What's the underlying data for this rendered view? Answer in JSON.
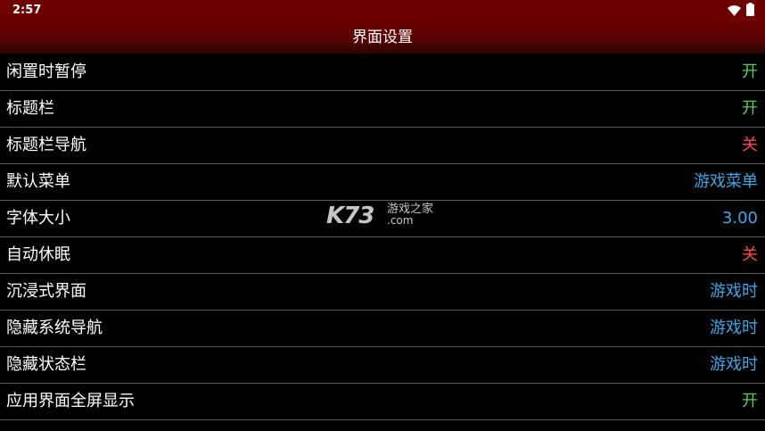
{
  "status_bar": {
    "time": "2:57",
    "icons": [
      "wifi-icon",
      "battery-icon"
    ]
  },
  "header": {
    "title": "界面设置"
  },
  "settings": [
    {
      "label": "闲置时暂停",
      "value": "开",
      "color": "#4cd35a"
    },
    {
      "label": "标题栏",
      "value": "开",
      "color": "#4cd35a"
    },
    {
      "label": "标题栏导航",
      "value": "关",
      "color": "#ff4a4a"
    },
    {
      "label": "默认菜单",
      "value": "游戏菜单",
      "color": "#37a9e6"
    },
    {
      "label": "字体大小",
      "value": "3.00",
      "color": "#37a9e6"
    },
    {
      "label": "自动休眠",
      "value": "关",
      "color": "#ff4a4a"
    },
    {
      "label": "沉浸式界面",
      "value": "游戏时",
      "color": "#37a9e6"
    },
    {
      "label": "隐藏系统导航",
      "value": "游戏时",
      "color": "#37a9e6"
    },
    {
      "label": "隐藏状态栏",
      "value": "游戏时",
      "color": "#37a9e6"
    },
    {
      "label": "应用界面全屏显示",
      "value": "开",
      "color": "#4cd35a"
    }
  ],
  "watermark": {
    "logo": "K73",
    "text_cn": "游戏之家",
    "text_com": ".com"
  },
  "colors": {
    "status_bar_bg": "#6e0000",
    "header_bg": "#5a0202",
    "on": "#4cd35a",
    "off": "#ff4a4a",
    "info": "#37a9e6",
    "divider": "#5a5a5a"
  }
}
